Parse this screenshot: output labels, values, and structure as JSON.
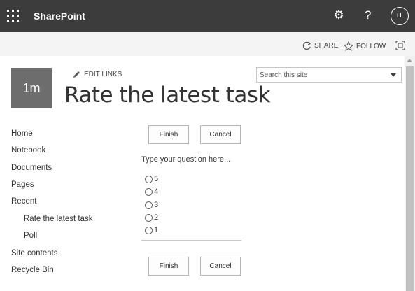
{
  "suite_bar": {
    "app_name": "SharePoint",
    "settings_icon": "gear-icon",
    "help_label": "?",
    "user_initials": "TL"
  },
  "command_bar": {
    "share_label": "SHARE",
    "follow_label": "FOLLOW"
  },
  "site": {
    "logo_text": "1m",
    "edit_links_label": "EDIT LINKS",
    "page_title": "Rate the latest task"
  },
  "search": {
    "placeholder": "Search this site"
  },
  "nav": {
    "items": [
      {
        "label": "Home"
      },
      {
        "label": "Notebook"
      },
      {
        "label": "Documents"
      },
      {
        "label": "Pages"
      },
      {
        "label": "Recent"
      },
      {
        "label": "Rate the latest task"
      },
      {
        "label": "Poll"
      },
      {
        "label": "Site contents"
      },
      {
        "label": "Recycle Bin"
      }
    ]
  },
  "form": {
    "finish_label": "Finish",
    "cancel_label": "Cancel",
    "question": "Type your question here...",
    "options": [
      "5",
      "4",
      "3",
      "2",
      "1"
    ]
  },
  "colors": {
    "suite_bar_bg": "#3c3c3c",
    "command_bar_bg": "#f4f4f4",
    "logo_bg": "#6d6d6d"
  }
}
